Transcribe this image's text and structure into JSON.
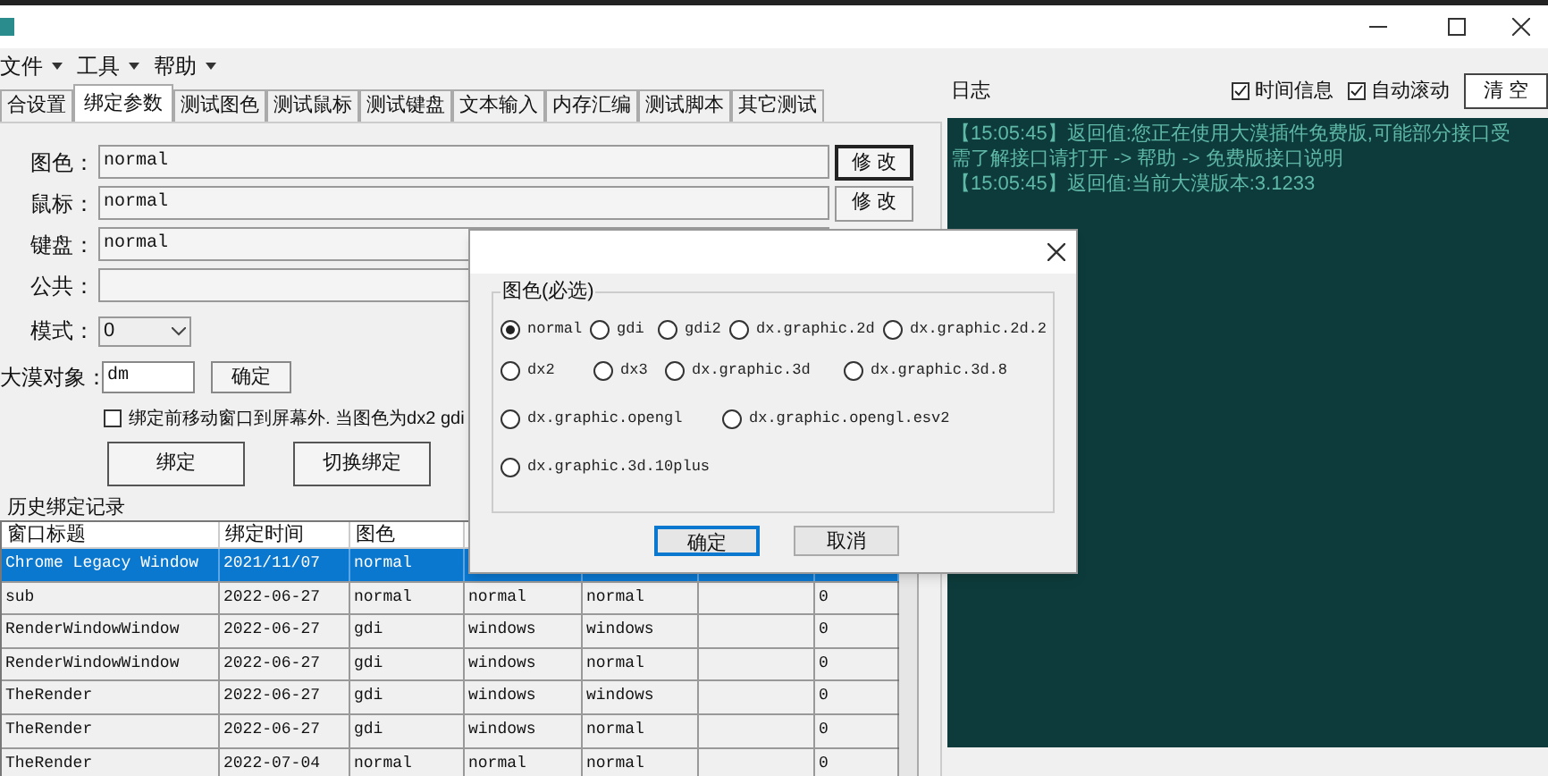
{
  "menu": [
    {
      "label": "文件"
    },
    {
      "label": "工具"
    },
    {
      "label": "帮助"
    }
  ],
  "tabs": [
    {
      "label": "合设置",
      "selected": false
    },
    {
      "label": "绑定参数",
      "selected": true
    },
    {
      "label": "测试图色",
      "selected": false
    },
    {
      "label": "测试鼠标",
      "selected": false
    },
    {
      "label": "测试键盘",
      "selected": false
    },
    {
      "label": "文本输入",
      "selected": false
    },
    {
      "label": "内存汇编",
      "selected": false
    },
    {
      "label": "测试脚本",
      "selected": false
    },
    {
      "label": "其它测试",
      "selected": false
    }
  ],
  "fields": [
    {
      "label": "图色：",
      "value": "normal",
      "button": "修 改"
    },
    {
      "label": "鼠标：",
      "value": "normal",
      "button": "修 改"
    },
    {
      "label": "键盘：",
      "value": "normal"
    },
    {
      "label": "公共："
    }
  ],
  "mode": {
    "label": "模式：",
    "value": "0"
  },
  "object": {
    "label": "大漠对象：",
    "value": "dm",
    "button": "确定"
  },
  "move_option": {
    "label": "绑定前移动窗口到屏幕外. 当图色为dx2 gdi",
    "checked": false
  },
  "actions": [
    "绑定",
    "切换绑定"
  ],
  "history": {
    "title": "历史绑定记录",
    "columns": [
      "窗口标题",
      "绑定时间",
      "图色"
    ],
    "rows": [
      {
        "selected": true,
        "cells": [
          "Chrome Legacy Window",
          "2021/11/07",
          "normal"
        ]
      },
      {
        "selected": false,
        "cells": [
          "sub",
          "2022-06-27",
          "normal",
          "normal",
          "normal",
          null,
          "0"
        ]
      },
      {
        "selected": false,
        "cells": [
          "RenderWindowWindow",
          "2022-06-27",
          "gdi",
          "windows",
          "windows",
          null,
          "0"
        ]
      },
      {
        "selected": false,
        "cells": [
          "RenderWindowWindow",
          "2022-06-27",
          "gdi",
          "windows",
          "normal",
          null,
          "0"
        ]
      },
      {
        "selected": false,
        "cells": [
          "TheRender",
          "2022-06-27",
          "gdi",
          "windows",
          "windows",
          null,
          "0"
        ]
      },
      {
        "selected": false,
        "cells": [
          "TheRender",
          "2022-06-27",
          "gdi",
          "windows",
          "normal",
          null,
          "0"
        ]
      },
      {
        "selected": false,
        "cells": [
          "TheRender",
          "2022-07-04",
          "normal",
          "normal",
          "normal",
          null,
          "0"
        ]
      }
    ]
  },
  "log": {
    "title": "日志",
    "options": [
      {
        "label": "时间信息",
        "checked": true
      },
      {
        "label": "自动滚动",
        "checked": true
      }
    ],
    "button": "清 空",
    "lines": [
      "【15:05:45】返回值:您正在使用大漠插件免费版,可能部分接口受",
      "需了解接口请打开 -> 帮助 -> 免费版接口说明",
      "【15:05:45】返回值:当前大漠版本:3.1233"
    ]
  },
  "dialog": {
    "group_title": "图色(必选)",
    "option_rows": [
      [
        {
          "label": "normal",
          "selected": true
        },
        {
          "label": "gdi",
          "selected": false
        },
        {
          "label": "gdi2",
          "selected": false
        },
        {
          "label": "dx.graphic.2d",
          "selected": false
        },
        {
          "label": "dx.graphic.2d.2",
          "selected": false
        }
      ],
      [
        {
          "label": "dx2",
          "selected": false
        },
        {
          "label": "dx3",
          "selected": false
        },
        {
          "label": "dx.graphic.3d",
          "selected": false
        },
        {
          "label": "dx.graphic.3d.8",
          "selected": false
        }
      ],
      [
        {
          "label": "dx.graphic.opengl",
          "selected": false
        },
        {
          "label": "dx.graphic.opengl.esv2",
          "selected": false
        }
      ],
      [
        {
          "label": "dx.graphic.3d.10plus",
          "selected": false
        }
      ]
    ],
    "buttons": [
      "确定",
      "取消"
    ]
  }
}
